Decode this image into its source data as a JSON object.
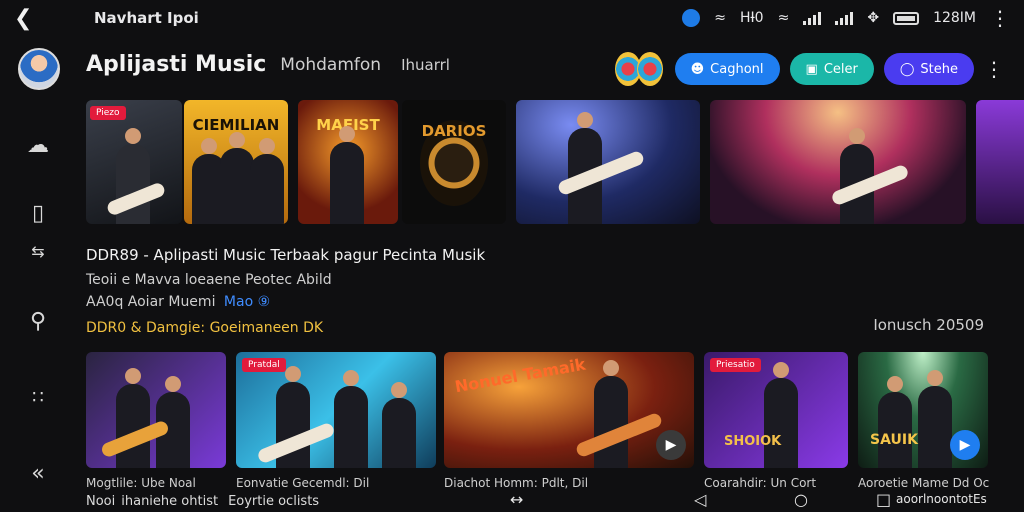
{
  "status_bar": {
    "title": "Navhart Ipoi",
    "network": "HƗ0",
    "time": "128IM"
  },
  "header": {
    "app_title": "Aplijasti Music",
    "subtitle": "Mohdamfon",
    "subtitle2": "Ihuarrl",
    "buttons": [
      {
        "label": "Caghonl",
        "icon": "user-icon"
      },
      {
        "label": "Celer",
        "icon": "image-icon"
      },
      {
        "label": "Stehe",
        "icon": "circle-icon"
      }
    ]
  },
  "top_tiles": [
    {
      "tag": "Piezo",
      "title": "",
      "style": "guitar-dark"
    },
    {
      "tag": "",
      "title": "CIEMILIAN",
      "style": "band-yellow"
    },
    {
      "tag": "",
      "title": "MAEIST",
      "style": "crowd-orange"
    },
    {
      "tag": "",
      "title": "DARIOS",
      "style": "logo-gold"
    },
    {
      "tag": "",
      "title": "",
      "style": "stage-blue"
    },
    {
      "tag": "",
      "title": "",
      "style": "concert-red"
    },
    {
      "tag": "",
      "title": "",
      "style": "purple-partial"
    }
  ],
  "content": {
    "headline": "DDR89 - Aplipasti Music Terbaak pagur Pecinta Musik",
    "line2": "Teoii e Mavva loeaene Peotec Abild",
    "line3": "AA0q Aoiar Muemi",
    "line3_badge": "Mao ⑨",
    "line4": "DDR0 & Damgie: Goeimaneen DK",
    "date": "Ionusch 20509"
  },
  "bottom_cards": [
    {
      "tag": "",
      "caption": "Mogtlile: Ube Noal"
    },
    {
      "tag": "Pratdal",
      "caption": "Eonvatie Gecemdl: Dil"
    },
    {
      "tag": "",
      "caption": "Diachot Homm: Pdlt, Dil"
    },
    {
      "tag": "Priesatio",
      "caption": "Coarahdir: Un Cort"
    },
    {
      "tag": "",
      "caption": "Aoroetie Mame Dd Oc"
    }
  ],
  "bottom_card_titles": [
    "",
    "",
    "Nonuel Tamaik",
    "SHOIOK",
    "SAUIK"
  ],
  "nav": {
    "left_text": "Nooi",
    "left_text2": "ihaniehe ohtist",
    "left_text3": "Eoyrtie oclists",
    "right_text": "aoorlnoontotEs"
  }
}
